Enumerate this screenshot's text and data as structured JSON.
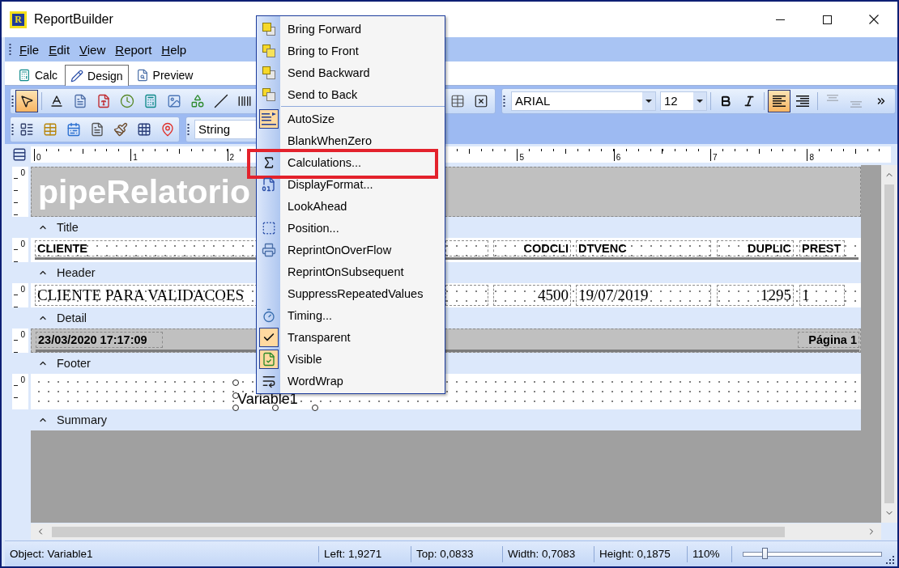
{
  "window": {
    "logo": "R",
    "title": "ReportBuilder"
  },
  "menu_bar": [
    "File",
    "Edit",
    "View",
    "Report",
    "Help"
  ],
  "tabs": [
    {
      "label": "Calc",
      "selected": false
    },
    {
      "label": "Design",
      "selected": true
    },
    {
      "label": "Preview",
      "selected": false
    }
  ],
  "toolbars": {
    "draw_tools": [
      {
        "selected": true
      },
      {
        "selected": false
      },
      {
        "selected": false
      },
      {
        "selected": false
      },
      {
        "selected": false
      },
      {
        "selected": false
      },
      {
        "selected": false
      },
      {
        "selected": false
      },
      {
        "selected": false
      },
      {
        "selected": false
      }
    ],
    "font": "ARIAL",
    "font_size": "12",
    "alignment": [
      {
        "selected": true,
        "disabled": false
      },
      {
        "selected": false,
        "disabled": false
      },
      {
        "selected": false,
        "disabled": true
      },
      {
        "selected": false,
        "disabled": true
      }
    ],
    "data_type": "String"
  },
  "ruler": {
    "left_labels": [
      "0",
      "1",
      "2"
    ],
    "right_labels": [
      "5",
      "6",
      "7",
      "8"
    ]
  },
  "bands": [
    {
      "kind": "banner",
      "label": "Title",
      "ruler_label": "0",
      "color": "#c0c0c0",
      "fields": [
        {
          "text": "pipeRelatorio",
          "selected": false
        }
      ]
    },
    {
      "kind": "headings",
      "label": "Header",
      "ruler_label": "0",
      "fields": [
        {
          "text": "CLIENTE",
          "selected": false
        },
        {
          "text": "CODCLI",
          "selected": false
        },
        {
          "text": "DTVENC",
          "selected": false
        },
        {
          "text": "DUPLIC",
          "selected": false
        },
        {
          "text": "PREST",
          "selected": false
        }
      ]
    },
    {
      "kind": "values",
      "label": "Detail",
      "ruler_label": "0",
      "fields": [
        {
          "text": "CLIENTE PARA VALIDACOES",
          "selected": false
        },
        {
          "text": "4500",
          "selected": false
        },
        {
          "text": "19/07/2019",
          "selected": false
        },
        {
          "text": "1295",
          "selected": false
        },
        {
          "text": "1",
          "selected": false
        }
      ]
    },
    {
      "kind": "footer_bar",
      "label": "Footer",
      "ruler_label": "0",
      "color": "#c0c0c0",
      "fields": [
        {
          "text": "23/03/2020 17:17:09",
          "selected": false
        },
        {
          "text": "Página 1",
          "selected": false
        }
      ]
    },
    {
      "kind": "free",
      "label": "Summary",
      "ruler_label": "0",
      "fields": [
        {
          "text": "Variable1",
          "selected": true
        }
      ]
    }
  ],
  "context_menu": {
    "groups": [
      [
        {
          "label": "Bring Forward",
          "checked": false,
          "annotated": false
        },
        {
          "label": "Bring to Front",
          "checked": false,
          "annotated": false
        },
        {
          "label": "Send Backward",
          "checked": false,
          "annotated": false
        },
        {
          "label": "Send to Back",
          "checked": false,
          "annotated": false
        }
      ],
      [
        {
          "label": "AutoSize",
          "checked": true,
          "annotated": false
        },
        {
          "label": "BlankWhenZero",
          "checked": false,
          "annotated": false
        },
        {
          "label": "Calculations...",
          "checked": false,
          "annotated": true
        },
        {
          "label": "DisplayFormat...",
          "checked": false,
          "annotated": false
        },
        {
          "label": "LookAhead",
          "checked": false,
          "annotated": false
        },
        {
          "label": "Position...",
          "checked": false,
          "annotated": false
        },
        {
          "label": "ReprintOnOverFlow",
          "checked": false,
          "annotated": false
        },
        {
          "label": "ReprintOnSubsequent",
          "checked": false,
          "annotated": false
        },
        {
          "label": "SuppressRepeatedValues",
          "checked": false,
          "annotated": false
        },
        {
          "label": "Timing...",
          "checked": false,
          "annotated": false
        },
        {
          "label": "Transparent",
          "checked": true,
          "annotated": false
        },
        {
          "label": "Visible",
          "checked": true,
          "annotated": false
        },
        {
          "label": "WordWrap",
          "checked": false,
          "annotated": false
        }
      ]
    ]
  },
  "status_bar": {
    "items": [
      "Object: Variable1",
      "Left: 1,9271",
      "Top: 0,0833",
      "Width: 0,7083",
      "Height: 0,1875",
      "110%"
    ],
    "zoom_slider": {
      "level": 0.15
    }
  }
}
